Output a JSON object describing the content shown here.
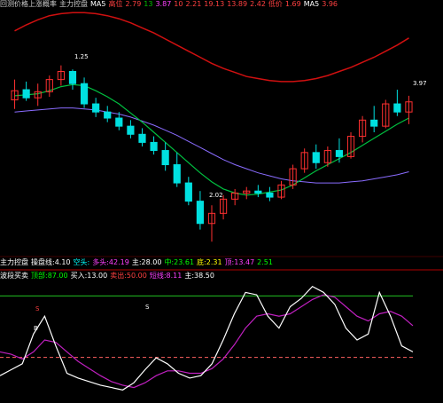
{
  "header": {
    "items": [
      {
        "text": "回测价格上涨概率",
        "color": "#cfcfcf"
      },
      {
        "text": "主力控盘",
        "color": "#cfcfcf"
      },
      {
        "text": "MA5",
        "color": "#ffffff"
      },
      {
        "text": "高位",
        "color": "#ff4040"
      },
      {
        "text": "2.79",
        "color": "#ff4040"
      },
      {
        "text": "13",
        "color": "#00c000"
      },
      {
        "text": "3.87",
        "color": "#ff40ff"
      },
      {
        "text": "10",
        "color": "#ff4040"
      },
      {
        "text": "2.21",
        "color": "#ff4040"
      },
      {
        "text": "19.13",
        "color": "#ff4040"
      },
      {
        "text": "13.89",
        "color": "#ff4040"
      },
      {
        "text": "2.42",
        "color": "#ff4040"
      },
      {
        "text": "低价",
        "color": "#ff4040"
      },
      {
        "text": "1.69",
        "color": "#ff4040"
      },
      {
        "text": "MA5",
        "color": "#ffffff"
      },
      {
        "text": "3.96",
        "color": "#ff4040"
      }
    ]
  },
  "indicator_bar": {
    "items": [
      {
        "text": "主力控盘",
        "color": "#ffffff"
      },
      {
        "text": "操盘线:4.10",
        "color": "#ffffff"
      },
      {
        "text": "空头:",
        "color": "#00ffff"
      },
      {
        "text": "多头:42.19",
        "color": "#ff40ff"
      },
      {
        "text": "主:28.00",
        "color": "#ffffff"
      },
      {
        "text": "中:23.61",
        "color": "#00ff00"
      },
      {
        "text": "底:2.31",
        "color": "#ffff00"
      },
      {
        "text": "顶:13.47",
        "color": "#ff40ff"
      },
      {
        "text": "2.51",
        "color": "#00ff00"
      }
    ]
  },
  "oscillator_bar": {
    "items": [
      {
        "text": "波段买卖",
        "color": "#ffffff"
      },
      {
        "text": "顶部:87.00",
        "color": "#00ff00"
      },
      {
        "text": "买入:13.00",
        "color": "#ffffff"
      },
      {
        "text": "卖出:50.00",
        "color": "#ff4040"
      },
      {
        "text": "短线:8.11",
        "color": "#ff40ff"
      },
      {
        "text": "主:38.50",
        "color": "#ffffff"
      }
    ]
  },
  "price_labels": {
    "high": "3.97",
    "low": "2.02",
    "y_max_label": "1.25"
  },
  "osc_labels": {
    "left_top": "S",
    "left_mid": "B",
    "right_top": "S"
  },
  "chart_data": [
    {
      "type": "candlestick",
      "candles": [
        {
          "o": 3.42,
          "h": 3.62,
          "l": 3.33,
          "c": 3.51
        },
        {
          "o": 3.52,
          "h": 3.6,
          "l": 3.41,
          "c": 3.44
        },
        {
          "o": 3.44,
          "h": 3.58,
          "l": 3.36,
          "c": 3.5
        },
        {
          "o": 3.5,
          "h": 3.66,
          "l": 3.45,
          "c": 3.62
        },
        {
          "o": 3.62,
          "h": 3.76,
          "l": 3.56,
          "c": 3.7
        },
        {
          "o": 3.7,
          "h": 3.72,
          "l": 3.52,
          "c": 3.58
        },
        {
          "o": 3.58,
          "h": 3.64,
          "l": 3.34,
          "c": 3.38
        },
        {
          "o": 3.38,
          "h": 3.44,
          "l": 3.25,
          "c": 3.3
        },
        {
          "o": 3.3,
          "h": 3.36,
          "l": 3.2,
          "c": 3.24
        },
        {
          "o": 3.24,
          "h": 3.3,
          "l": 3.12,
          "c": 3.16
        },
        {
          "o": 3.16,
          "h": 3.22,
          "l": 3.04,
          "c": 3.08
        },
        {
          "o": 3.08,
          "h": 3.14,
          "l": 2.96,
          "c": 3.0
        },
        {
          "o": 3.0,
          "h": 3.06,
          "l": 2.88,
          "c": 2.92
        },
        {
          "o": 2.92,
          "h": 3.0,
          "l": 2.72,
          "c": 2.78
        },
        {
          "o": 2.78,
          "h": 2.9,
          "l": 2.56,
          "c": 2.6
        },
        {
          "o": 2.6,
          "h": 2.66,
          "l": 2.38,
          "c": 2.42
        },
        {
          "o": 2.42,
          "h": 2.52,
          "l": 2.14,
          "c": 2.2
        },
        {
          "o": 2.2,
          "h": 2.38,
          "l": 2.02,
          "c": 2.3
        },
        {
          "o": 2.3,
          "h": 2.48,
          "l": 2.24,
          "c": 2.44
        },
        {
          "o": 2.44,
          "h": 2.54,
          "l": 2.38,
          "c": 2.5
        },
        {
          "o": 2.5,
          "h": 2.56,
          "l": 2.44,
          "c": 2.52
        },
        {
          "o": 2.52,
          "h": 2.58,
          "l": 2.46,
          "c": 2.5
        },
        {
          "o": 2.5,
          "h": 2.56,
          "l": 2.42,
          "c": 2.46
        },
        {
          "o": 2.46,
          "h": 2.62,
          "l": 2.44,
          "c": 2.58
        },
        {
          "o": 2.58,
          "h": 2.78,
          "l": 2.54,
          "c": 2.74
        },
        {
          "o": 2.74,
          "h": 2.94,
          "l": 2.7,
          "c": 2.9
        },
        {
          "o": 2.9,
          "h": 2.98,
          "l": 2.74,
          "c": 2.8
        },
        {
          "o": 2.8,
          "h": 2.96,
          "l": 2.76,
          "c": 2.92
        },
        {
          "o": 2.92,
          "h": 3.04,
          "l": 2.8,
          "c": 2.86
        },
        {
          "o": 2.86,
          "h": 3.1,
          "l": 2.84,
          "c": 3.06
        },
        {
          "o": 3.06,
          "h": 3.26,
          "l": 3.0,
          "c": 3.22
        },
        {
          "o": 3.22,
          "h": 3.36,
          "l": 3.1,
          "c": 3.16
        },
        {
          "o": 3.16,
          "h": 3.42,
          "l": 3.14,
          "c": 3.38
        },
        {
          "o": 3.38,
          "h": 3.52,
          "l": 3.26,
          "c": 3.3
        },
        {
          "o": 3.3,
          "h": 3.46,
          "l": 3.18,
          "c": 3.4
        }
      ],
      "ylim": [
        1.9,
        4.3
      ],
      "ma_short": [
        3.46,
        3.47,
        3.48,
        3.51,
        3.55,
        3.57,
        3.56,
        3.51,
        3.45,
        3.38,
        3.29,
        3.2,
        3.1,
        3.0,
        2.9,
        2.8,
        2.7,
        2.61,
        2.54,
        2.5,
        2.48,
        2.49,
        2.51,
        2.53,
        2.58,
        2.65,
        2.72,
        2.78,
        2.84,
        2.9,
        2.97,
        3.04,
        3.11,
        3.18,
        3.24
      ],
      "ma_long": [
        3.3,
        3.31,
        3.32,
        3.33,
        3.34,
        3.34,
        3.33,
        3.32,
        3.3,
        3.28,
        3.25,
        3.21,
        3.17,
        3.12,
        3.07,
        3.01,
        2.95,
        2.89,
        2.83,
        2.78,
        2.74,
        2.7,
        2.67,
        2.64,
        2.62,
        2.61,
        2.6,
        2.6,
        2.6,
        2.61,
        2.62,
        2.64,
        2.66,
        2.68,
        2.71
      ],
      "ma_trend": [
        4.1,
        4.16,
        4.21,
        4.25,
        4.27,
        4.28,
        4.28,
        4.27,
        4.25,
        4.22,
        4.18,
        4.13,
        4.08,
        4.02,
        3.96,
        3.9,
        3.84,
        3.78,
        3.73,
        3.69,
        3.65,
        3.63,
        3.61,
        3.6,
        3.6,
        3.61,
        3.63,
        3.66,
        3.7,
        3.74,
        3.79,
        3.84,
        3.9,
        3.96,
        4.03
      ]
    },
    {
      "type": "line",
      "ylim": [
        0,
        100
      ],
      "white": [
        20,
        25,
        30,
        55,
        70,
        45,
        22,
        18,
        15,
        12,
        10,
        8,
        14,
        25,
        35,
        30,
        22,
        18,
        20,
        30,
        50,
        72,
        90,
        88,
        70,
        60,
        78,
        85,
        95,
        90,
        80,
        60,
        50,
        55,
        90,
        70,
        45,
        40
      ],
      "magenta": [
        40,
        38,
        34,
        40,
        50,
        48,
        40,
        32,
        26,
        20,
        15,
        12,
        10,
        14,
        20,
        24,
        24,
        22,
        22,
        26,
        34,
        46,
        60,
        70,
        72,
        70,
        72,
        78,
        84,
        88,
        86,
        78,
        70,
        66,
        72,
        74,
        70,
        62
      ],
      "ref_top": 87,
      "ref_mid": 13
    }
  ]
}
